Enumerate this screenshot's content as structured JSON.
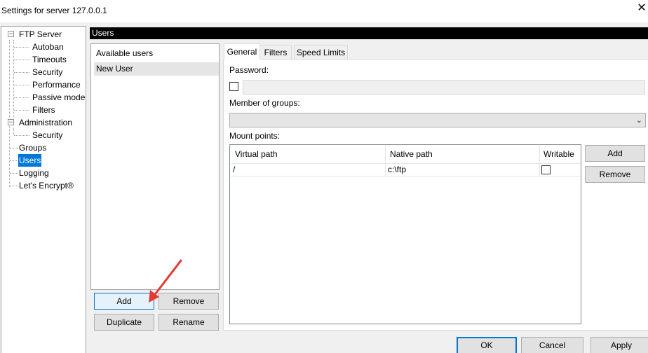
{
  "window": {
    "title": "Settings for server 127.0.0.1",
    "close_glyph": "✕"
  },
  "tree": {
    "expand_glyph": "−",
    "items": [
      {
        "label": "FTP Server"
      },
      {
        "label": "Autoban"
      },
      {
        "label": "Timeouts"
      },
      {
        "label": "Security"
      },
      {
        "label": "Performance"
      },
      {
        "label": "Passive mode"
      },
      {
        "label": "Filters"
      },
      {
        "label": "Administration"
      },
      {
        "label": "Security"
      },
      {
        "label": "Groups"
      },
      {
        "label": "Users",
        "selected": true
      },
      {
        "label": "Logging"
      },
      {
        "label": "Let's Encrypt®"
      }
    ]
  },
  "section_title": "Users",
  "users_panel": {
    "header": "Available users",
    "users": [
      "New User"
    ],
    "buttons": {
      "add": "Add",
      "remove": "Remove",
      "duplicate": "Duplicate",
      "rename": "Rename"
    }
  },
  "tabs": [
    "General",
    "Filters",
    "Speed Limits"
  ],
  "active_tab": "General",
  "general": {
    "password_label": "Password:",
    "password_enabled": false,
    "password_value": "",
    "groups_label": "Member of groups:",
    "groups_value": "",
    "mount_points_label": "Mount points:",
    "mount_columns": [
      "Virtual path",
      "Native path",
      "Writable"
    ],
    "mount_rows": [
      {
        "virtual_path": "/",
        "native_path": "c:\\ftp",
        "writable": false
      }
    ],
    "mount_buttons": {
      "add": "Add",
      "remove": "Remove"
    }
  },
  "footer_buttons": {
    "ok": "OK",
    "cancel": "Cancel",
    "apply": "Apply"
  },
  "colors": {
    "selection": "#0078d7",
    "annotation_arrow": "#e53935"
  },
  "icons": {
    "close": "close-icon",
    "tree_expander": "collapse-icon",
    "checkbox": "checkbox-icon",
    "dropdown": "chevron-down-icon"
  }
}
